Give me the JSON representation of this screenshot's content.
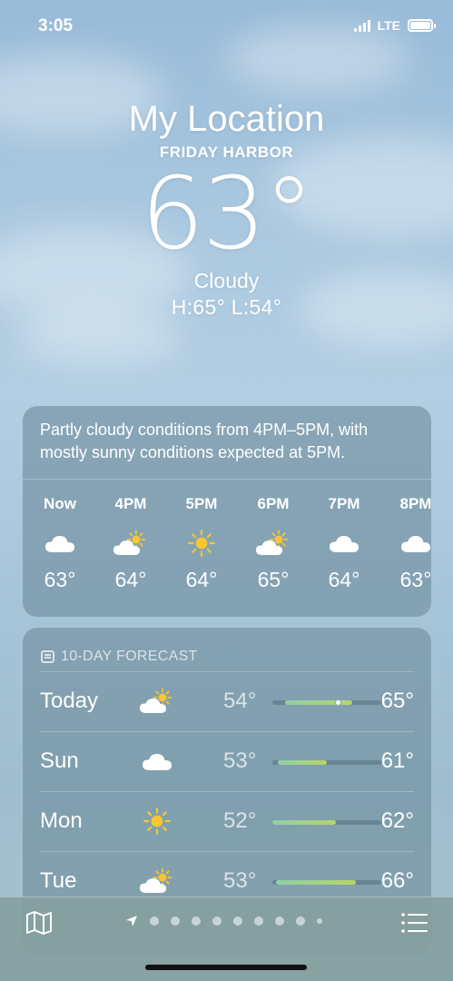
{
  "status": {
    "time": "3:05",
    "network": "LTE"
  },
  "hero": {
    "location": "My Location",
    "sublocation": "FRIDAY HARBOR",
    "temperature": "63°",
    "condition": "Cloudy",
    "high_low": "H:65°  L:54°"
  },
  "hourly": {
    "summary": "Partly cloudy conditions from 4PM–5PM, with mostly sunny conditions expected at 5PM.",
    "hours": [
      {
        "label": "Now",
        "icon": "cloud-icon",
        "temp": "63°"
      },
      {
        "label": "4PM",
        "icon": "partly-sunny-icon",
        "temp": "64°"
      },
      {
        "label": "5PM",
        "icon": "sun-icon",
        "temp": "64°"
      },
      {
        "label": "6PM",
        "icon": "partly-sunny-icon",
        "temp": "65°"
      },
      {
        "label": "7PM",
        "icon": "cloud-icon",
        "temp": "64°"
      },
      {
        "label": "8PM",
        "icon": "cloud-icon",
        "temp": "63°"
      }
    ]
  },
  "forecast": {
    "title": "10-DAY FORECAST",
    "days": [
      {
        "day": "Today",
        "icon": "partly-sunny-icon",
        "low": "54°",
        "high": "65°",
        "range_start": 0.12,
        "range_end": 0.73,
        "current": 0.6
      },
      {
        "day": "Sun",
        "icon": "cloud-icon",
        "low": "53°",
        "high": "61°",
        "range_start": 0.05,
        "range_end": 0.5
      },
      {
        "day": "Mon",
        "icon": "sun-icon",
        "low": "52°",
        "high": "62°",
        "range_start": 0.0,
        "range_end": 0.58
      },
      {
        "day": "Tue",
        "icon": "partly-sunny-icon",
        "low": "53°",
        "high": "66°",
        "range_start": 0.03,
        "range_end": 0.77
      }
    ]
  },
  "colors": {
    "sun": "#f7c631",
    "track": "#466473",
    "range_gradient_start": "#8fd0a8",
    "range_gradient_end": "#b7d46a"
  },
  "bottom": {
    "page_count": 9,
    "active_page": 0
  }
}
